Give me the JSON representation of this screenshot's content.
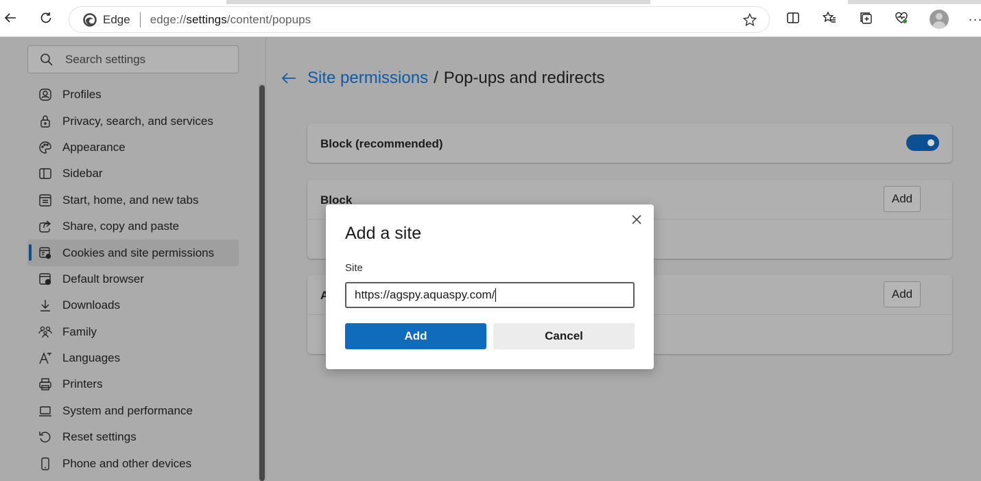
{
  "browser": {
    "address_label": "Edge",
    "url_prefix": "edge://",
    "url_host": "settings",
    "url_path": "/content/popups"
  },
  "toolbar": {
    "back": "back-arrow-icon",
    "refresh": "refresh-icon",
    "favorite": "star-icon",
    "split": "split-screen-icon",
    "favorites": "favorites-icon",
    "collections": "collections-icon",
    "browser_essentials": "heartbeat-icon",
    "profile": "avatar",
    "more": "more-icon",
    "more_glyph": "···"
  },
  "sidebar": {
    "search_placeholder": "Search settings",
    "items": [
      {
        "label": "Profiles",
        "icon": "profile-icon"
      },
      {
        "label": "Privacy, search, and services",
        "icon": "lock-icon"
      },
      {
        "label": "Appearance",
        "icon": "palette-icon"
      },
      {
        "label": "Sidebar",
        "icon": "sidebar-icon"
      },
      {
        "label": "Start, home, and new tabs",
        "icon": "home-tabs-icon"
      },
      {
        "label": "Share, copy and paste",
        "icon": "share-icon"
      },
      {
        "label": "Cookies and site permissions",
        "icon": "cookie-permissions-icon",
        "active": true
      },
      {
        "label": "Default browser",
        "icon": "default-browser-icon"
      },
      {
        "label": "Downloads",
        "icon": "download-icon"
      },
      {
        "label": "Family",
        "icon": "family-icon"
      },
      {
        "label": "Languages",
        "icon": "languages-icon"
      },
      {
        "label": "Printers",
        "icon": "printer-icon"
      },
      {
        "label": "System and performance",
        "icon": "laptop-icon"
      },
      {
        "label": "Reset settings",
        "icon": "reset-icon"
      },
      {
        "label": "Phone and other devices",
        "icon": "phone-icon"
      }
    ]
  },
  "main": {
    "breadcrumb_parent": "Site permissions",
    "breadcrumb_sep": "/",
    "breadcrumb_current": "Pop-ups and redirects",
    "block_recommended_label": "Block (recommended)",
    "block_recommended_on": true,
    "block_section_title": "Block",
    "allow_section_title_partial": "A",
    "add_label": "Add"
  },
  "dialog": {
    "title": "Add a site",
    "field_label": "Site",
    "field_value": "https://agspy.aquaspy.com/",
    "primary_label": "Add",
    "secondary_label": "Cancel"
  },
  "colors": {
    "accent": "#0f6cbd",
    "link": "#0d5ca8",
    "toggle_on": "#0d4f93",
    "overlay_bg": "#ababab"
  }
}
